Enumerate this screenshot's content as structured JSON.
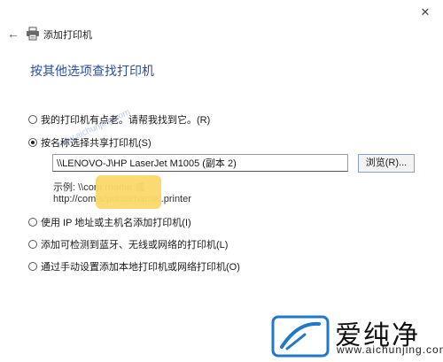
{
  "window": {
    "title": "添加打印机",
    "close_icon": "close-icon",
    "back_icon": "back-arrow-icon"
  },
  "heading": "按其他选项查找打印机",
  "options": {
    "not_listed": "我的打印机有点老。请帮我找到它。(R)",
    "select_shared": "按名称选择共享打印机(S)",
    "tcpip": "使用 IP 地址或主机名添加打印机(I)",
    "bluetooth": "添加可检测到蓝牙、无线或网络的打印机(L)",
    "manual": "通过手动设置添加本地打印机或网络打印机(O)"
  },
  "selected_option": "select_shared",
  "shared_printer": {
    "value": "\\\\LENOVO-J\\HP LaserJet M1005 (副本 2)",
    "browse_label": "浏览(R)...",
    "example_line1": "示例: \\\\com                 rname 或",
    "example_line2": "http://com                 s/printername/.printer"
  },
  "watermark": {
    "brand_cn": "爱纯净",
    "url": "www.aichunjing.com",
    "diagonal": "www.aichunjing.com"
  },
  "colors": {
    "heading": "#2b4fa0",
    "redaction": "#fbd86a"
  }
}
